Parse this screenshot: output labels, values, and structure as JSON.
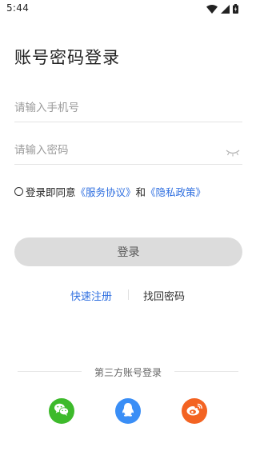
{
  "status_bar": {
    "time": "5:44",
    "icons": [
      "wifi-icon",
      "signal-icon",
      "battery-icon"
    ]
  },
  "page": {
    "title": "账号密码登录"
  },
  "form": {
    "phone_placeholder": "请输入手机号",
    "password_placeholder": "请输入密码",
    "password_toggle_icon": "eye-closed-icon"
  },
  "agreement": {
    "prefix": "登录即同意",
    "service_link": "《服务协议》",
    "conjunction": "和",
    "privacy_link": "《隐私政策》",
    "checked": false
  },
  "actions": {
    "login_label": "登录",
    "register_label": "快速注册",
    "recover_label": "找回密码"
  },
  "third_party": {
    "title": "第三方账号登录",
    "providers": [
      {
        "name": "wechat",
        "icon": "wechat-icon",
        "color": "#3dba2b"
      },
      {
        "name": "qq",
        "icon": "qq-icon",
        "color": "#3a8ef6"
      },
      {
        "name": "weibo",
        "icon": "weibo-icon",
        "color": "#f36322"
      }
    ]
  },
  "colors": {
    "link": "#2f6fe0",
    "button_bg": "#dcdcdc"
  }
}
